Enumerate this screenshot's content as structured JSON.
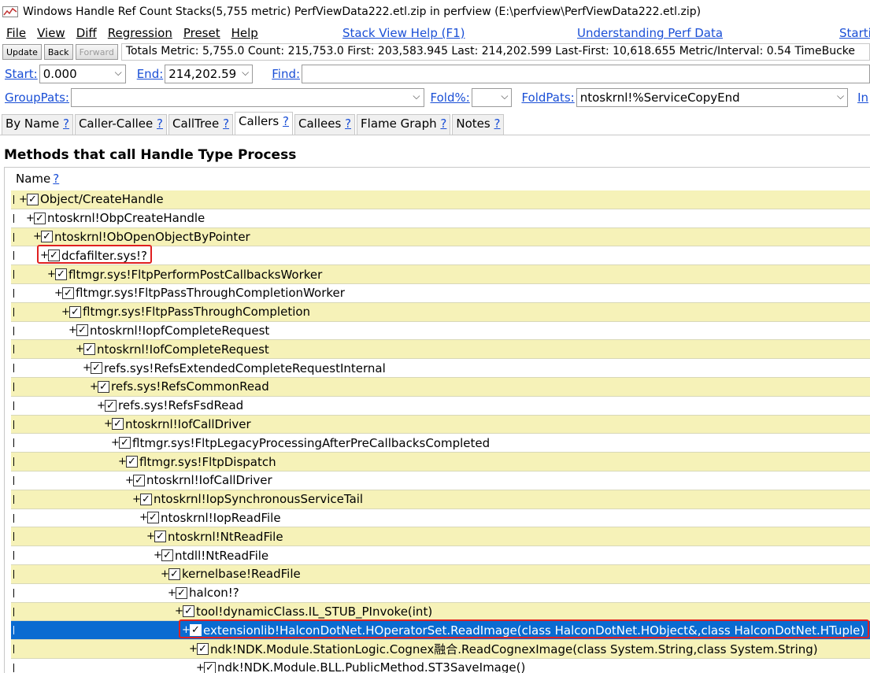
{
  "window": {
    "title": "Windows Handle Ref Count Stacks(5,755 metric) PerfViewData222.etl.zip in perfview (E:\\perfview\\PerfViewData222.etl.zip)",
    "app_icon": "perfview-chart-icon"
  },
  "menu": {
    "items": [
      {
        "label": "File"
      },
      {
        "label": "View"
      },
      {
        "label": "Diff"
      },
      {
        "label": "Regression"
      },
      {
        "label": "Preset"
      },
      {
        "label": "Help"
      }
    ],
    "links": [
      "Stack View Help (F1)",
      "Understanding Perf Data",
      "Starti"
    ]
  },
  "toolbar": {
    "update_label": "Update",
    "back_label": "Back",
    "forward_label": "Forward",
    "totals": "Totals Metric: 5,755.0  Count: 215,753.0  First: 203,583.945  Last: 214,202.599  Last-First: 10,618.655  Metric/Interval: 0.54  TimeBucke"
  },
  "range": {
    "start_label": "Start:",
    "start_value": "0.000",
    "end_label": "End:",
    "end_value": "214,202.59",
    "find_label": "Find:",
    "find_value": ""
  },
  "patterns": {
    "grouppats_label": "GroupPats:",
    "grouppats_value": "",
    "fold_label": "Fold%:",
    "fold_value": "",
    "foldpats_label": "FoldPats:",
    "foldpats_value": "ntoskrnl!%ServiceCopyEnd",
    "incpats_label": "In"
  },
  "tabs": [
    {
      "label": "By Name",
      "help": "?"
    },
    {
      "label": "Caller-Callee",
      "help": "?"
    },
    {
      "label": "CallTree",
      "help": "?"
    },
    {
      "label": "Callers",
      "help": "?"
    },
    {
      "label": "Callees",
      "help": "?"
    },
    {
      "label": "Flame Graph",
      "help": "?"
    },
    {
      "label": "Notes",
      "help": "?"
    }
  ],
  "active_tab": "Callers",
  "main": {
    "heading": "Methods that call Handle Type Process",
    "column_name": "Name",
    "column_help": "?",
    "rows": [
      {
        "text": "Object/CreateHandle",
        "checked": "✓"
      },
      {
        "text": "ntoskrnl!ObpCreateHandle",
        "checked": "✓"
      },
      {
        "text": "ntoskrnl!ObOpenObjectByPointer",
        "checked": "✓"
      },
      {
        "text": "dcfafilter.sys!?",
        "checked": "✓"
      },
      {
        "text": "fltmgr.sys!FltpPerformPostCallbacksWorker",
        "checked": "✓"
      },
      {
        "text": "fltmgr.sys!FltpPassThroughCompletionWorker",
        "checked": "✓"
      },
      {
        "text": "fltmgr.sys!FltpPassThroughCompletion",
        "checked": "✓"
      },
      {
        "text": "ntoskrnl!IopfCompleteRequest",
        "checked": "✓"
      },
      {
        "text": "ntoskrnl!IofCompleteRequest",
        "checked": "✓"
      },
      {
        "text": "refs.sys!RefsExtendedCompleteRequestInternal",
        "checked": "✓"
      },
      {
        "text": "refs.sys!RefsCommonRead",
        "checked": "✓"
      },
      {
        "text": "refs.sys!RefsFsdRead",
        "checked": "✓"
      },
      {
        "text": "ntoskrnl!IofCallDriver",
        "checked": "✓"
      },
      {
        "text": "fltmgr.sys!FltpLegacyProcessingAfterPreCallbacksCompleted",
        "checked": "✓"
      },
      {
        "text": "fltmgr.sys!FltpDispatch",
        "checked": "✓"
      },
      {
        "text": "ntoskrnl!IofCallDriver",
        "checked": "✓"
      },
      {
        "text": "ntoskrnl!IopSynchronousServiceTail",
        "checked": "✓"
      },
      {
        "text": "ntoskrnl!IopReadFile",
        "checked": "✓"
      },
      {
        "text": "ntoskrnl!NtReadFile",
        "checked": "✓"
      },
      {
        "text": "ntdll!NtReadFile",
        "checked": "✓"
      },
      {
        "text": "kernelbase!ReadFile",
        "checked": "✓"
      },
      {
        "text": "halcon!?",
        "checked": "✓"
      },
      {
        "text": "tool!dynamicClass.IL_STUB_PInvoke(int)",
        "checked": "✓"
      },
      {
        "text": "extensionlib!HalconDotNet.HOperatorSet.ReadImage(class HalconDotNet.HObject&,class HalconDotNet.HTuple)",
        "checked": "✓"
      },
      {
        "text": "ndk!NDK.Module.StationLogic.Cognex融合.ReadCognexImage(class System.String,class System.String)",
        "checked": "✓"
      },
      {
        "text": "ndk!NDK.Module.BLL.PublicMethod.ST3SaveImage()",
        "checked": "✓"
      }
    ],
    "selected_row": "extensionlib!HalconDotNet.HOperatorSet.ReadImage(class HalconDotNet.HObject&,class HalconDotNet.HTuple)",
    "highlighted_rows": [
      "dcfafilter.sys!?",
      "extensionlib!HalconDotNet.HOperatorSet.ReadImage(class HalconDotNet.HObject&,class HalconDotNet.HTuple)"
    ]
  },
  "colors": {
    "link": "#1a4fd6",
    "row_alt": "#f6f2b8",
    "selection": "#0a6bd1",
    "highlight_box": "#e02020"
  }
}
